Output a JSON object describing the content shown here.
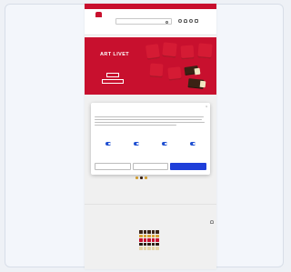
{
  "promo_bar": {
    "text": ""
  },
  "header": {
    "logo_text": "",
    "search_placeholder": "",
    "icons": [
      "location-icon",
      "wishlist-icon",
      "account-icon",
      "cart-icon"
    ]
  },
  "nav": {
    "items": [
      "",
      "",
      "",
      "",
      "",
      "",
      "",
      ""
    ]
  },
  "banner": {
    "title": "ART LIVET",
    "subtitle": "",
    "button_primary": "",
    "button_secondary": "",
    "background_color": "#c8102e"
  },
  "cookie_dialog": {
    "brand": "",
    "close": "×",
    "title": "",
    "categories": [
      {
        "label": ""
      },
      {
        "label": ""
      },
      {
        "label": ""
      },
      {
        "label": ""
      }
    ],
    "details_link": "",
    "buttons": {
      "deny": "",
      "allow_selection": "",
      "allow_all": ""
    },
    "accent_color": "#1f3fd9"
  },
  "featured": {
    "label": "",
    "price": ""
  },
  "section": {
    "label": ""
  },
  "product": {
    "name": "",
    "price": ""
  }
}
